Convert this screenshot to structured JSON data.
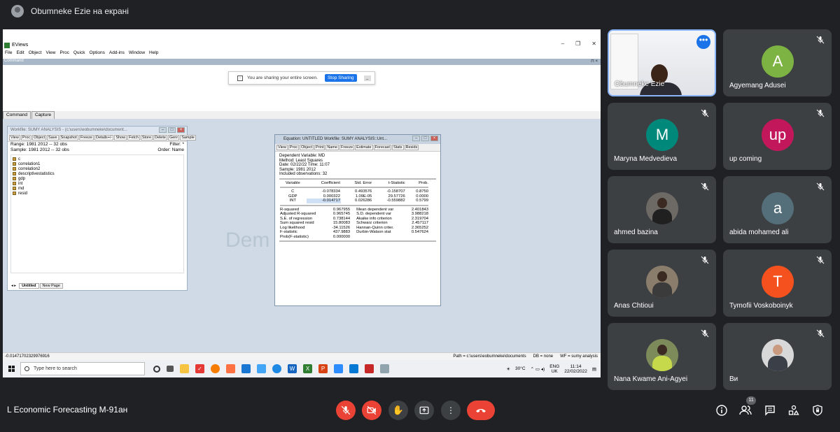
{
  "presenter_banner": "Obumneke Ezie на екрані",
  "eviews": {
    "title": "EViews",
    "menu": [
      "File",
      "Edit",
      "Object",
      "View",
      "Proc",
      "Quick",
      "Options",
      "Add-ins",
      "Window",
      "Help"
    ],
    "command_label": "Command",
    "tabs": [
      "Command",
      "Capture"
    ],
    "share_bar": {
      "message": "You are sharing your entire screen.",
      "stop_label": "Stop Sharing"
    },
    "watermark": "Dem",
    "workfile": {
      "title": "Workfile: SUMY ANALYSIS - (c:\\users\\eobumneke\\document...",
      "toolbar": [
        "View",
        "Proc",
        "Object",
        "Save",
        "Snapshot",
        "Freeze",
        "Details+/-",
        "Show",
        "Fetch",
        "Store",
        "Delete",
        "Genr",
        "Sample"
      ],
      "range": "Range: 1981 2012 -- 32 obs",
      "filter": "Filter: *",
      "sample": "Sample: 1981 2012 -- 32 obs",
      "order": "Order: Name",
      "objects": [
        "c",
        "correlation1",
        "correlation2",
        "descriptivestatistics",
        "gdp",
        "int",
        "md",
        "resid"
      ],
      "page_tabs": [
        "Untitled",
        "New Page"
      ]
    },
    "equation": {
      "title": "Equation: UNTITLED   Workfile: SUMY ANALYSIS::Unt...",
      "toolbar": [
        "View",
        "Proc",
        "Object",
        "Print",
        "Name",
        "Freeze",
        "Estimate",
        "Forecast",
        "Stats",
        "Resids"
      ],
      "header": [
        "Dependent Variable: MD",
        "Method: Least Squares",
        "Date: 02/22/22   Time: 11:07",
        "Sample: 1981 2012",
        "Included observations: 32"
      ],
      "columns": [
        "Variable",
        "Coefficient",
        "Std. Error",
        "t-Statistic",
        "Prob."
      ],
      "rows": [
        [
          "C",
          "-0.078334",
          "0.493576",
          "-0.158707",
          "0.8750"
        ],
        [
          "GDP",
          "0.000322",
          "1.09E-05",
          "29.57726",
          "0.0000"
        ],
        [
          "INT",
          "-0.014717",
          "0.026286",
          "-0.559882",
          "0.5799"
        ]
      ],
      "stats": [
        [
          "R-squared",
          "0.967955",
          "Mean dependent var",
          "2.401843"
        ],
        [
          "Adjusted R-squared",
          "0.965745",
          "S.D. dependent var",
          "3.988218"
        ],
        [
          "S.E. of regression",
          "0.738144",
          "Akaike info criterion",
          "2.319704"
        ],
        [
          "Sum squared resid",
          "15.80083",
          "Schwarz criterion",
          "2.457117"
        ],
        [
          "Log likelihood",
          "-34.11526",
          "Hannan-Quinn criter.",
          "2.365252"
        ],
        [
          "F-statistic",
          "437.9883",
          "Durbin-Watson stat",
          "0.547624"
        ],
        [
          "Prob(F-statistic)",
          "0.000000",
          "",
          ""
        ]
      ]
    },
    "status": {
      "value": "-0.0147170232997691​6",
      "path": "Path = c:\\users\\eobumneke\\documents",
      "db": "DB = none",
      "wf": "WF = sumy analysis"
    }
  },
  "taskbar": {
    "search_placeholder": "Type here to search",
    "temperature": "30°C",
    "lang1": "ENG",
    "lang2": "UK",
    "time": "11:14",
    "date": "22/02/2022"
  },
  "participants": [
    {
      "name": "Obumneke Ezie",
      "type": "video"
    },
    {
      "name": "Agyemang Adusei",
      "initial": "A",
      "color": "#7cb342"
    },
    {
      "name": "Maryna Medvedieva",
      "initial": "M",
      "color": "#00897b"
    },
    {
      "name": "up coming",
      "initial": "up",
      "color": "#c2185b"
    },
    {
      "name": "ahmed bazina",
      "type": "photo"
    },
    {
      "name": "abida mohamed ali",
      "initial": "a",
      "color": "#546e7a"
    },
    {
      "name": "Anas Chtioui",
      "type": "photo"
    },
    {
      "name": "Tymofii Voskoboinyk",
      "initial": "T",
      "color": "#f4511e"
    },
    {
      "name": "Nana Kwame Ani-Agyei",
      "type": "photo"
    },
    {
      "name": "Ви",
      "type": "photo"
    }
  ],
  "meeting_name": "L Economic Forecasting M-91ан",
  "participant_count": "11"
}
